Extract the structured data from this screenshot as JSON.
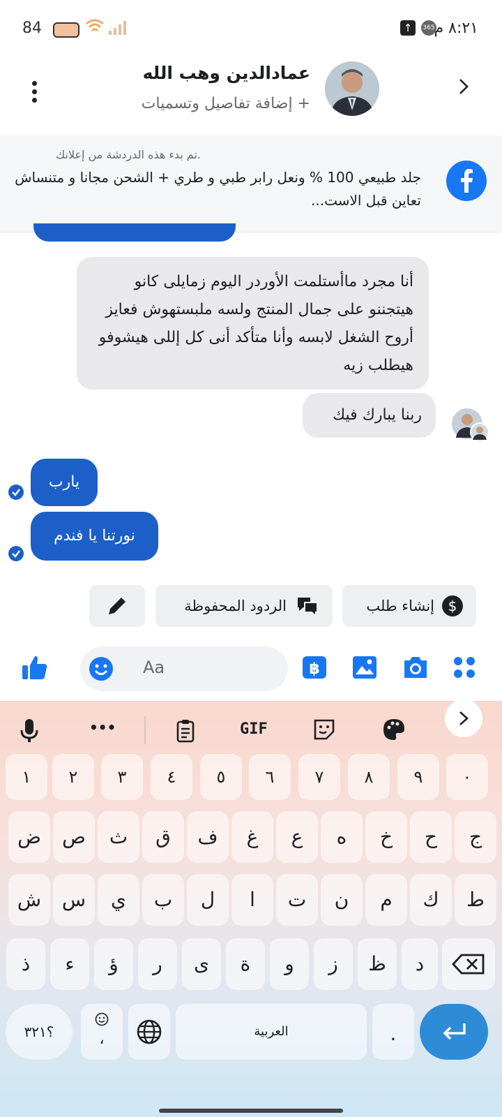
{
  "status_bar": {
    "time": "٨:٢١ م",
    "battery": "84",
    "badge_365": "365",
    "up_arrow": "↑"
  },
  "header": {
    "name": "عمادالدين وهب الله",
    "subtitle": "+ إضافة تفاصيل وتسميات"
  },
  "ad_banner": {
    "note": ".تم بدء هذه الدردشة من إعلانك",
    "text": "جلد طبيعي 100 % ونعل رابر طبي و طري  + الشحن مجانا و متنساش تعاين قبل الاست..."
  },
  "messages": [
    {
      "side": "in",
      "text": "أنا مجرد ماأستلمت الأوردر اليوم زمايلى كانو هيتجننو على جمال المنتج ولسه ملبستهوش فعايز أروح الشغل لابسه وأنا متأكد أنى كل إللى هيشوفو هيطلب زيه"
    },
    {
      "side": "in",
      "text": "ربنا يبارك فيك"
    },
    {
      "side": "out",
      "text": "يارب"
    },
    {
      "side": "out",
      "text": "نورتنا يا فندم"
    }
  ],
  "actions": {
    "create_order": "إنشاء طلب",
    "saved_replies": "الردود المحفوظة"
  },
  "composer": {
    "placeholder": "Aa"
  },
  "keyboard": {
    "toolbar": {
      "gif": "GIF",
      "more": "•••"
    },
    "numbers": [
      "٠",
      "٩",
      "٨",
      "٧",
      "٦",
      "٥",
      "٤",
      "٣",
      "٢",
      "١"
    ],
    "row1": [
      "ج",
      "ح",
      "خ",
      "ه",
      "ع",
      "غ",
      "ف",
      "ق",
      "ث",
      "ص",
      "ض"
    ],
    "row2": [
      "ط",
      "ك",
      "م",
      "ن",
      "ت",
      "ا",
      "ل",
      "ب",
      "ي",
      "س",
      "ش"
    ],
    "row3": [
      "د",
      "ظ",
      "ز",
      "و",
      "ة",
      "ى",
      "ر",
      "ؤ",
      "ء",
      "ذ"
    ],
    "symbols": "؟٣٢١",
    "comma": "،",
    "space": "العربية",
    "period": "."
  },
  "colors": {
    "messenger_blue": "#1c5fc9",
    "facebook_blue": "#1877f2",
    "bubble_gray": "#e9e9eb"
  }
}
